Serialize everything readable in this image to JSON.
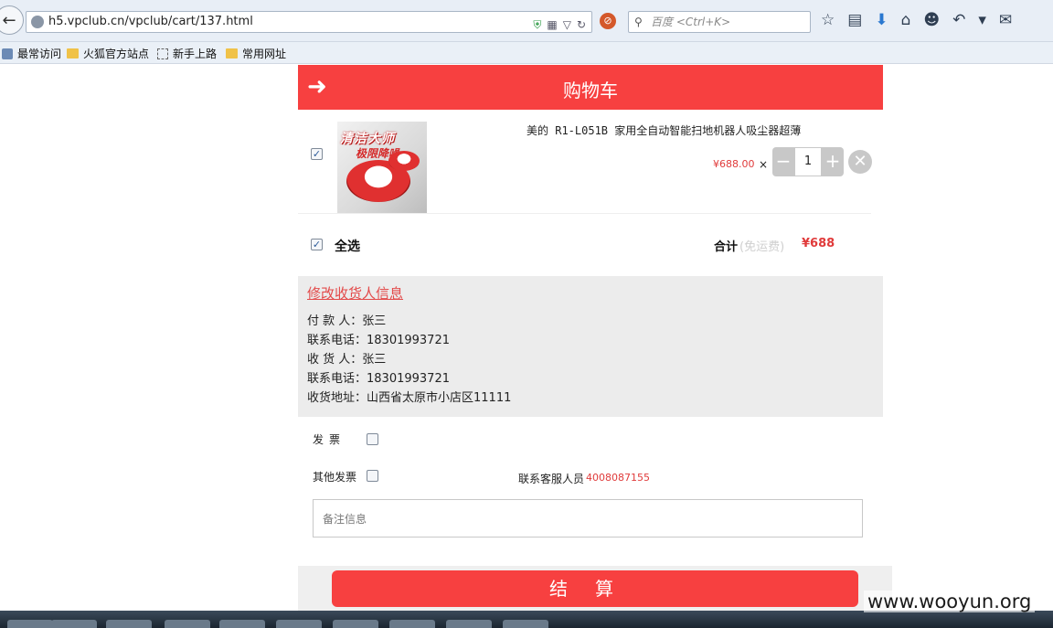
{
  "browser": {
    "url": "h5.vpclub.cn/vpclub/cart/137.html",
    "search_placeholder": "百度 <Ctrl+K>",
    "bookmarks": [
      "最常访问",
      "火狐官方站点",
      "新手上路",
      "常用网址"
    ]
  },
  "header": {
    "title": "购物车"
  },
  "cart_item": {
    "name": "美的 R1-L051B 家用全自动智能扫地机器人吸尘器超薄",
    "image_text_1": "清洁大师",
    "image_text_2": "极限降噪",
    "price": "¥688.00",
    "times": "×",
    "quantity": "1",
    "minus": "−",
    "plus": "+",
    "remove": "✕",
    "checked": true
  },
  "summary": {
    "select_all": "全选",
    "total_label": "合计",
    "free_shipping": "(免运费)",
    "total_value": "¥688"
  },
  "receiver": {
    "edit_link": "修改收货人信息",
    "lines": [
      "付 款 人：张三",
      "联系电话：18301993721",
      "收 货 人：张三",
      "联系电话：18301993721",
      "收货地址：山西省太原市小店区11111"
    ]
  },
  "invoice": {
    "label": "发票",
    "other_label": "其他发票"
  },
  "service": {
    "label": "联系客服人员",
    "phone": "4008087155"
  },
  "remark": {
    "placeholder": "备注信息"
  },
  "checkout": {
    "label": "结算"
  },
  "watermark": "www.wooyun.org",
  "colors": {
    "accent": "#f74040",
    "price": "#e03b3b"
  }
}
